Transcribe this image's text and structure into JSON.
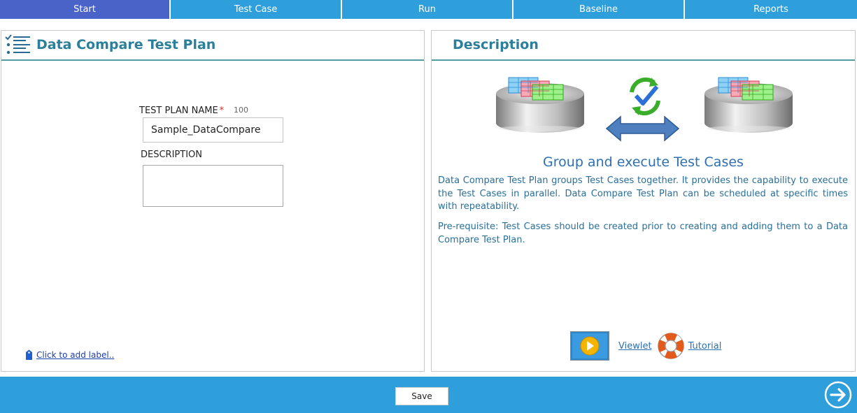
{
  "tabs": [
    {
      "label": "Start",
      "active": true
    },
    {
      "label": "Test Case",
      "active": false
    },
    {
      "label": "Run",
      "active": false
    },
    {
      "label": "Baseline",
      "active": false
    },
    {
      "label": "Reports",
      "active": false
    }
  ],
  "left_panel": {
    "title": "Data Compare Test Plan",
    "icon": "checklist-icon",
    "test_plan_name": {
      "label": "TEST PLAN NAME",
      "required_mark": "*",
      "max_length": "100",
      "value": "Sample_DataCompare"
    },
    "description": {
      "label": "DESCRIPTION",
      "value": ""
    },
    "add_label_link": "Click to add label.."
  },
  "right_panel": {
    "title": "Description",
    "heading": "Group and execute Test Cases",
    "paragraph1": "Data Compare Test Plan groups Test Cases together. It provides the capability to execute the Test Cases in parallel. Data Compare Test Plan can be scheduled at specific times with repeatability.",
    "paragraph2": "Pre-requisite: Test Cases should be created prior to creating and adding them to a Data Compare Test Plan.",
    "viewlet_link": "Viewlet",
    "tutorial_link": "Tutorial"
  },
  "bottom_bar": {
    "save_label": "Save"
  },
  "colors": {
    "tab_bar": "#2f9fdb",
    "tab_active": "#4a63c8",
    "title_text": "#2c7f9a",
    "header_rule": "#4f9ea1",
    "heading_blue": "#2d70b3",
    "bottom_bar": "#2f9fdb"
  }
}
